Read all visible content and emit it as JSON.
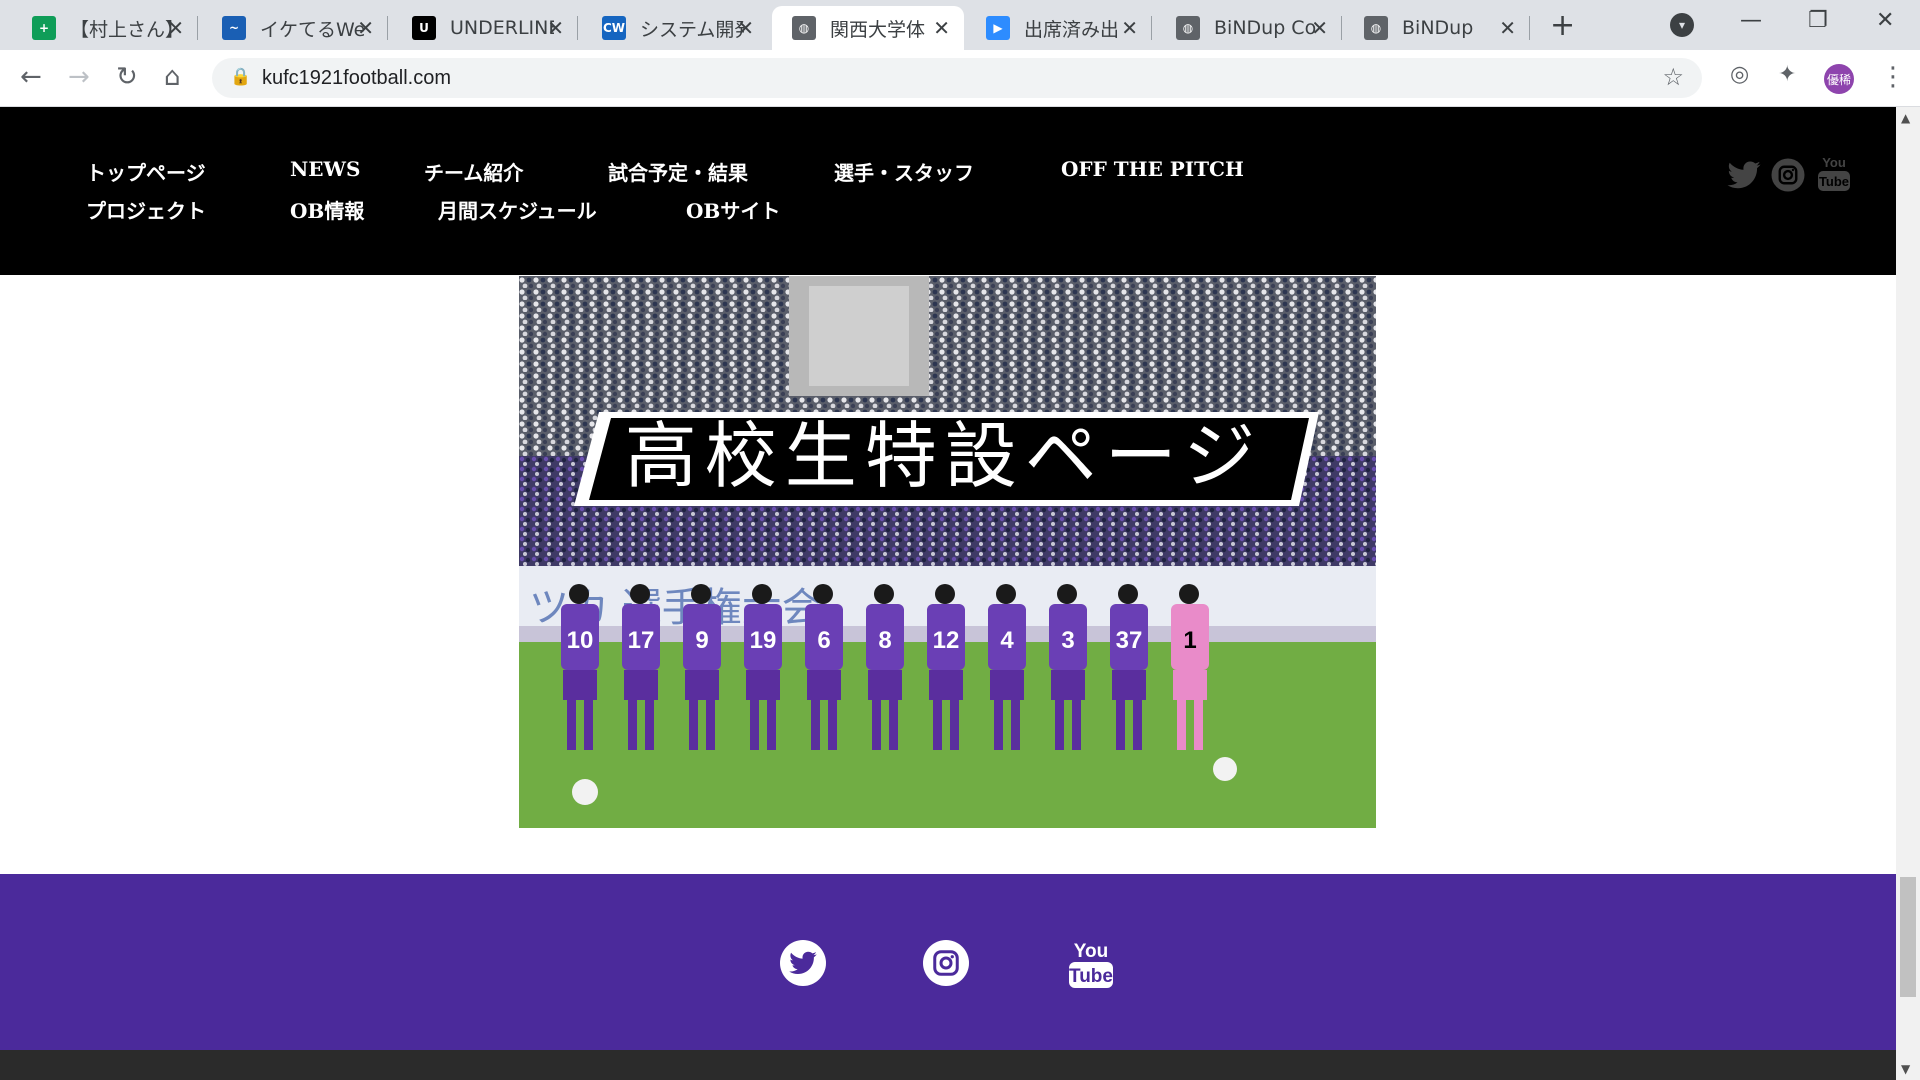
{
  "browser": {
    "tabs": [
      {
        "title": "【村上さん】",
        "favicon": "sheets-icon",
        "color": "#0f9d58",
        "glyph": "+"
      },
      {
        "title": "イケてるWeb",
        "favicon": "analytics-icon",
        "color": "#1a5fb4",
        "glyph": "~"
      },
      {
        "title": "UNDERLINE",
        "favicon": "underline-icon",
        "color": "#000000",
        "glyph": "U"
      },
      {
        "title": "システム開発",
        "favicon": "cw-icon",
        "color": "#1565c0",
        "glyph": "CW"
      },
      {
        "title": "関西大学体",
        "favicon": "globe-icon",
        "color": "#5f6368",
        "glyph": "◍"
      },
      {
        "title": "出席済み出",
        "favicon": "zoom-icon",
        "color": "#2d8cff",
        "glyph": "▶"
      },
      {
        "title": "BiNDup Co",
        "favicon": "globe-icon",
        "color": "#5f6368",
        "glyph": "◍"
      },
      {
        "title": "BiNDup",
        "favicon": "globe-icon",
        "color": "#5f6368",
        "glyph": "◍"
      }
    ],
    "active_tab_index": 4,
    "url": "kufc1921football.com",
    "avatar_label": "優稀"
  },
  "site": {
    "nav_row1": [
      "トップページ",
      "NEWS",
      "チーム紹介",
      "試合予定・結果",
      "選手・スタッフ",
      "OFF THE PITCH"
    ],
    "nav_row2": [
      "プロジェクト",
      "OB情報",
      "月間スケジュール",
      "OBサイト"
    ],
    "social": [
      "twitter-icon",
      "instagram-icon",
      "youtube-icon"
    ],
    "hero_title": "高校生特設ページ",
    "jersey_numbers": [
      "10",
      "17",
      "9",
      "19",
      "6",
      "8",
      "12",
      "4",
      "3",
      "37",
      "1"
    ],
    "footer_color": "#4b2a9b"
  }
}
